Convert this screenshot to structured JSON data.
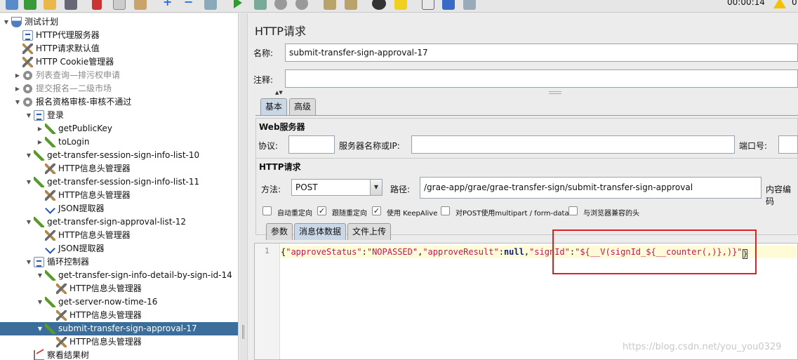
{
  "toolbar": {
    "icons": [
      "templates-icon",
      "open-icon",
      "save-icon",
      "cut-icon",
      "copy-icon",
      "paste-icon",
      "expand-icon",
      "collapse-icon",
      "toggle-icon",
      "start-icon",
      "start-no-pause-icon",
      "stop-icon",
      "shutdown-icon",
      "clear-icon",
      "clear-all-icon",
      "search-icon",
      "reset-search-icon",
      "function-helper-icon",
      "help-icon",
      "remote-icon"
    ],
    "elapsed_time": "00:00:14",
    "warning_count": "0"
  },
  "tree": {
    "nodes": [
      {
        "label": "测试计划",
        "icon": "test-plan-icon"
      },
      {
        "label": "HTTP代理服务器",
        "icon": "proxy-icon"
      },
      {
        "label": "HTTP请求默认值",
        "icon": "wrench-icon"
      },
      {
        "label": "HTTP Cookie管理器",
        "icon": "wrench-icon"
      },
      {
        "label": "列表查询—排污权申请",
        "icon": "thread-group-icon"
      },
      {
        "label": "提交报名—二级市场",
        "icon": "thread-group-icon"
      },
      {
        "label": "报名资格审核-审核不通过",
        "icon": "thread-group-icon"
      },
      {
        "label": "登录",
        "icon": "script-icon"
      },
      {
        "label": "getPublicKey",
        "icon": "sampler-icon"
      },
      {
        "label": "toLogin",
        "icon": "sampler-icon"
      },
      {
        "label": "get-transfer-session-sign-info-list-10",
        "icon": "sampler-icon"
      },
      {
        "label": "HTTP信息头管理器",
        "icon": "wrench-icon"
      },
      {
        "label": "get-transfer-session-sign-info-list-11",
        "icon": "sampler-icon"
      },
      {
        "label": "HTTP信息头管理器",
        "icon": "wrench-icon"
      },
      {
        "label": "JSON提取器",
        "icon": "json-extractor-icon"
      },
      {
        "label": "get-transfer-sign-approval-list-12",
        "icon": "sampler-icon"
      },
      {
        "label": "HTTP信息头管理器",
        "icon": "wrench-icon"
      },
      {
        "label": "JSON提取器",
        "icon": "json-extractor-icon"
      },
      {
        "label": "循环控制器",
        "icon": "script-icon"
      },
      {
        "label": "get-transfer-sign-info-detail-by-sign-id-14",
        "icon": "sampler-icon"
      },
      {
        "label": "HTTP信息头管理器",
        "icon": "wrench-icon"
      },
      {
        "label": "get-server-now-time-16",
        "icon": "sampler-icon"
      },
      {
        "label": "HTTP信息头管理器",
        "icon": "wrench-icon"
      },
      {
        "label": "submit-transfer-sign-approval-17",
        "icon": "sampler-icon"
      },
      {
        "label": "HTTP信息头管理器",
        "icon": "wrench-icon"
      },
      {
        "label": "察看结果树",
        "icon": "result-tree-icon"
      }
    ]
  },
  "panel": {
    "title": "HTTP请求",
    "name_label": "名称:",
    "name_value": "submit-transfer-sign-approval-17",
    "comment_label": "注释:",
    "comment_value": "",
    "tabs": [
      "基本",
      "高级"
    ],
    "web_server": {
      "title": "Web服务器",
      "protocol_label": "协议:",
      "protocol_value": "",
      "server_label": "服务器名称或IP:",
      "server_value": "",
      "port_label": "端口号:",
      "port_value": ""
    },
    "http_request": {
      "title": "HTTP请求",
      "method_label": "方法:",
      "method_value": "POST",
      "path_label": "路径:",
      "path_value": "/grae-app/grae/grae-transfer-sign/submit-transfer-sign-approval",
      "encoding_label": "内容编码"
    },
    "options": [
      {
        "label": "自动重定向",
        "checked": false
      },
      {
        "label": "跟随重定向",
        "checked": true
      },
      {
        "label": "使用 KeepAlive",
        "checked": true
      },
      {
        "label": "对POST使用multipart / form-data",
        "checked": false
      },
      {
        "label": "与浏览器兼容的头",
        "checked": false
      }
    ],
    "body_tabs": [
      "参数",
      "消息体数据",
      "文件上传"
    ],
    "editor": {
      "line_number": "1",
      "tokens": [
        {
          "t": "{",
          "k": "pun"
        },
        {
          "t": "\"approveStatus\"",
          "k": "str"
        },
        {
          "t": ":",
          "k": "pun"
        },
        {
          "t": "\"NOPASSED\"",
          "k": "str"
        },
        {
          "t": ",",
          "k": "pun"
        },
        {
          "t": "\"approveResult\"",
          "k": "str"
        },
        {
          "t": ":",
          "k": "pun"
        },
        {
          "t": "null",
          "k": "kw"
        },
        {
          "t": ",",
          "k": "pun"
        },
        {
          "t": "\"signId\"",
          "k": "str"
        },
        {
          "t": ":",
          "k": "pun"
        },
        {
          "t": "\"${__V(signId_${__counter(,)},)}\"",
          "k": "str"
        }
      ],
      "closing": "}"
    }
  },
  "watermark": "https://blog.csdn.net/you_you0329"
}
